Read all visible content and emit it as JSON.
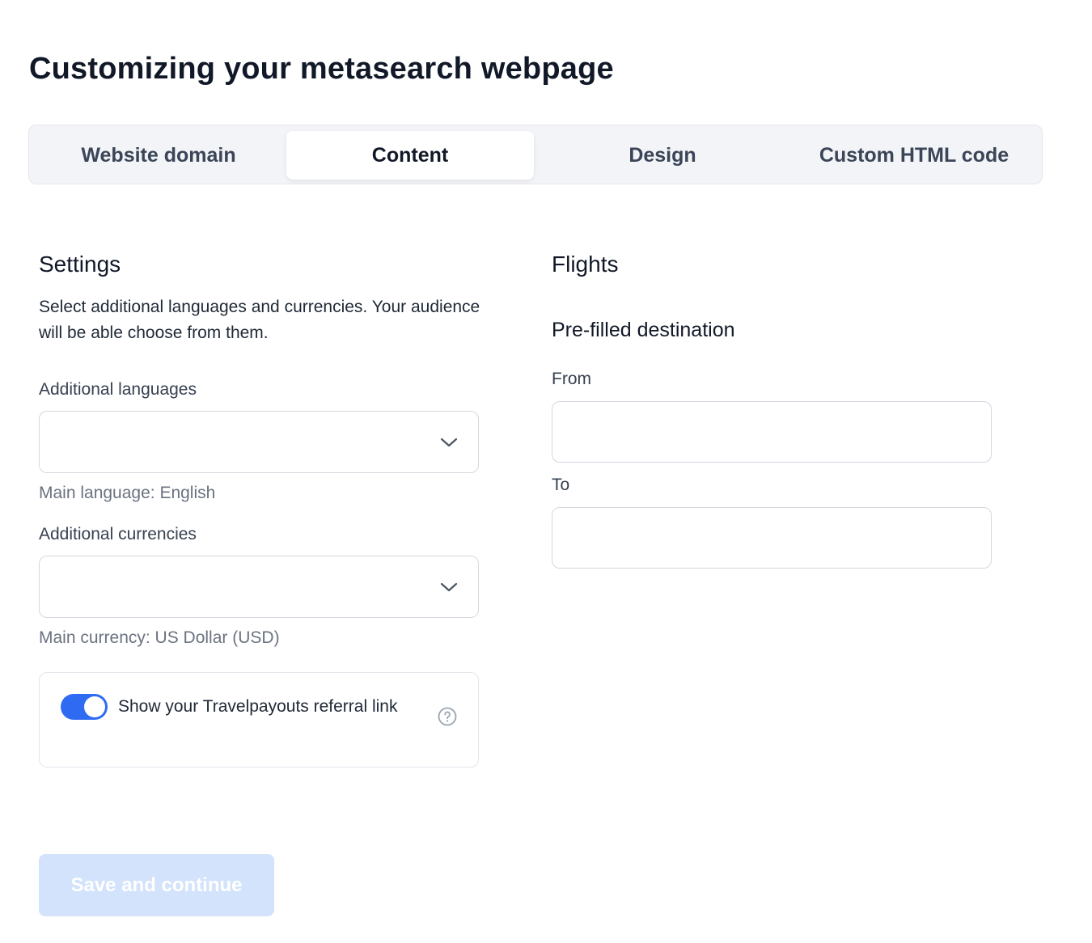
{
  "page": {
    "title": "Customizing your metasearch webpage"
  },
  "tabs": [
    {
      "label": "Website domain",
      "active": false
    },
    {
      "label": "Content",
      "active": true
    },
    {
      "label": "Design",
      "active": false
    },
    {
      "label": "Custom HTML code",
      "active": false
    }
  ],
  "settings": {
    "title": "Settings",
    "description": "Select additional languages and currencies. Your audience will be able choose from them.",
    "languages": {
      "label": "Additional languages",
      "value": "",
      "hint": "Main language: English"
    },
    "currencies": {
      "label": "Additional currencies",
      "value": "",
      "hint": "Main currency: US Dollar (USD)"
    },
    "referral": {
      "label": "Show your Travelpayouts referral link",
      "enabled": true
    }
  },
  "flights": {
    "title": "Flights",
    "subtitle": "Pre-filled destination",
    "from": {
      "label": "From",
      "value": "",
      "placeholder": ""
    },
    "to": {
      "label": "To",
      "value": "",
      "placeholder": ""
    }
  },
  "footer": {
    "save_label": "Save and continue",
    "save_disabled": true
  },
  "colors": {
    "accent": "#2f6bf2",
    "button_disabled_bg": "#d3e3fb",
    "tab_bar_bg": "#f3f4f7"
  },
  "icons": {
    "select_chevron": "chevron-down-icon",
    "help": "question-circle-icon"
  }
}
